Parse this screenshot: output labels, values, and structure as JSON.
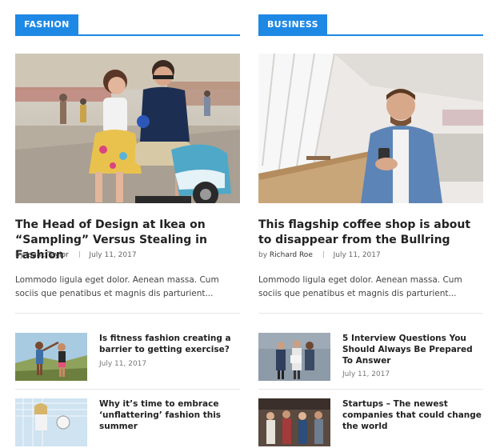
{
  "left": {
    "section": "FASHION",
    "featured": {
      "title": "The Head of Design at Ikea on “Sampling” Versus Stealing in Fashion",
      "by": "by",
      "author": "Isaac Taylor",
      "date": "July 11, 2017",
      "excerpt": "Lommodo ligula eget dolor. Aenean massa. Cum sociis que penatibus et magnis dis parturient..."
    },
    "list": [
      {
        "title": "Is fitness fashion creating a barrier to getting exercise?",
        "date": "July 11, 2017"
      },
      {
        "title": "Why it’s time to embrace ‘unflattering’ fashion this summer",
        "date": ""
      }
    ]
  },
  "right": {
    "section": "BUSINESS",
    "featured": {
      "title": "This flagship coffee shop is about to disappear from the Bullring",
      "by": "by",
      "author": "Richard Roe",
      "date": "July 11, 2017",
      "excerpt": "Lommodo ligula eget dolor. Aenean massa. Cum sociis que penatibus et magnis dis parturient..."
    },
    "list": [
      {
        "title": "5 Interview Questions You Should Always Be Prepared To Answer",
        "date": "July 11, 2017"
      },
      {
        "title": "Startups – The newest companies that could change the world",
        "date": ""
      }
    ]
  },
  "colors": {
    "accent": "#1e88e5",
    "text": "#222222",
    "muted": "#777777",
    "divider": "#e5e5e5"
  }
}
